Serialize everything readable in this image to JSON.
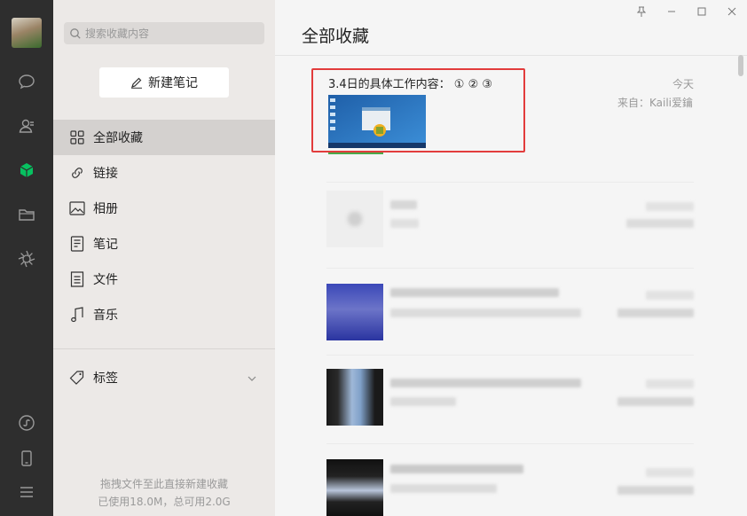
{
  "sidebar": {
    "search_placeholder": "搜索收藏内容",
    "new_note_label": "新建笔记",
    "nav": [
      {
        "label": "全部收藏",
        "icon": "grid-icon"
      },
      {
        "label": "链接",
        "icon": "link-icon"
      },
      {
        "label": "相册",
        "icon": "image-icon"
      },
      {
        "label": "笔记",
        "icon": "note-icon"
      },
      {
        "label": "文件",
        "icon": "file-icon"
      },
      {
        "label": "音乐",
        "icon": "music-icon"
      }
    ],
    "tags_label": "标签",
    "footer_line1": "拖拽文件至此直接新建收藏",
    "footer_line2": "已使用18.0M，总可用2.0G"
  },
  "rail": {
    "icons": [
      "chat-icon",
      "contacts-icon",
      "favorites-icon",
      "folder-icon",
      "moments-icon",
      "mini-program-icon",
      "phone-icon",
      "menu-icon"
    ],
    "active": "favorites-icon"
  },
  "main": {
    "title": "全部收藏",
    "items": [
      {
        "title": "3.4日的具体工作内容： ① ② ③",
        "date": "今天",
        "source": "来自：Kaili爱鑰"
      }
    ]
  },
  "colors": {
    "accent_green": "#07c160",
    "highlight_red": "#e23c3c",
    "rail_bg": "#2e2e2e",
    "sidebar_bg": "#ece9e7"
  }
}
